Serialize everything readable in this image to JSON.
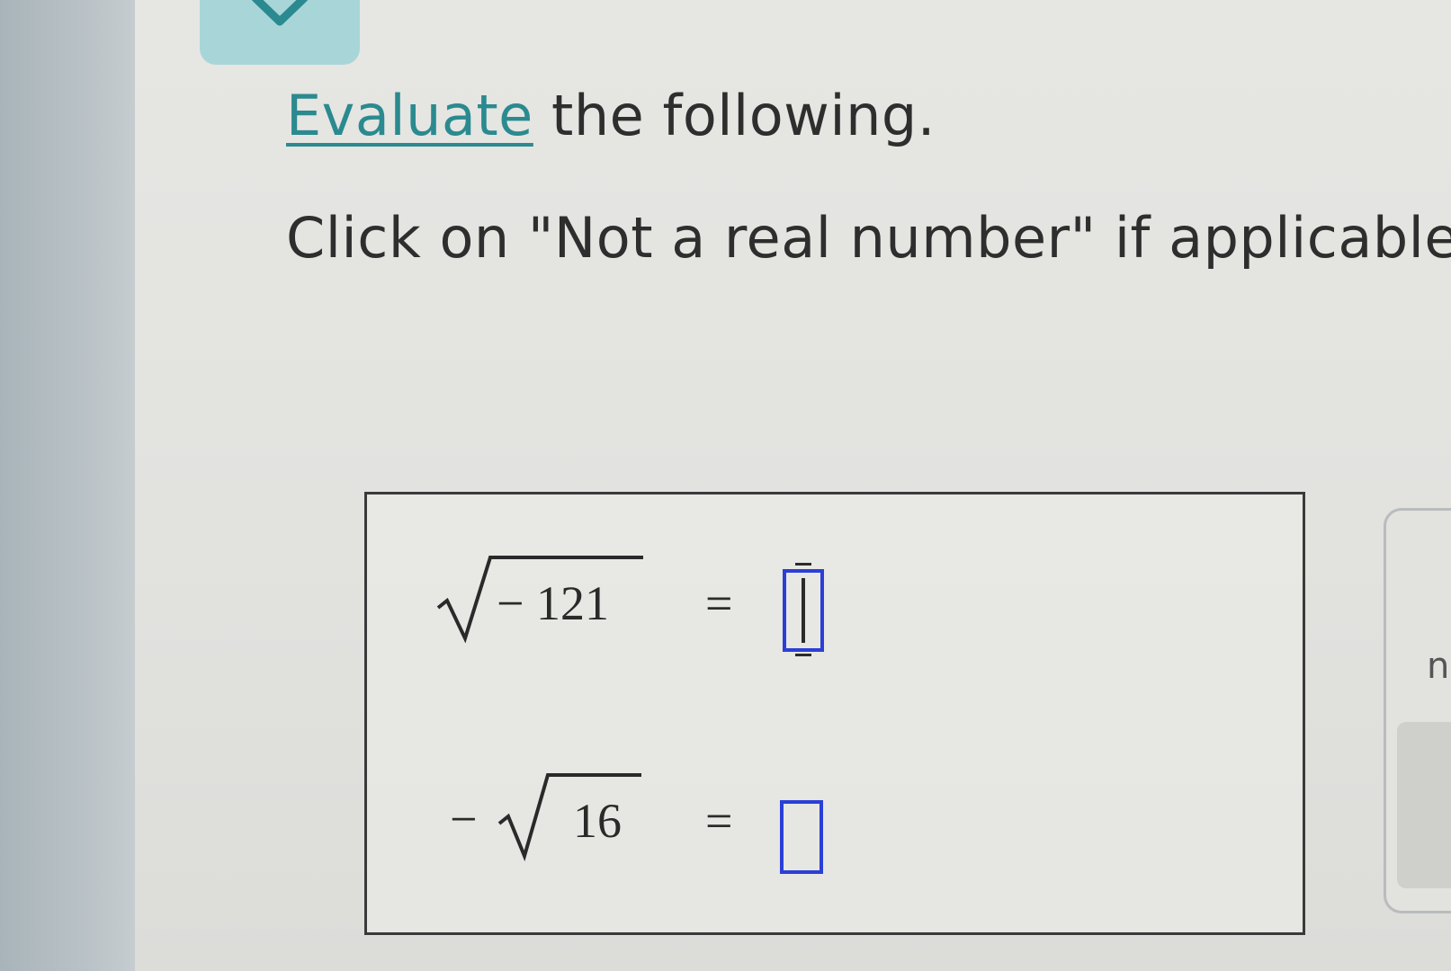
{
  "header": {
    "collapse_icon": "chevron-down-icon",
    "accent_color": "#a8d6d8"
  },
  "prompt": {
    "link_text": "Evaluate",
    "heading_rest": " the following.",
    "instruction": "Click on \"Not a real number\" if applicable."
  },
  "problems": [
    {
      "negative_prefix": "",
      "radicand": "− 121",
      "equals": "=",
      "answer_value": ""
    },
    {
      "negative_prefix": "−",
      "radicand": "16",
      "equals": "=",
      "answer_value": ""
    }
  ],
  "side_panel": {
    "label": "n"
  },
  "colors": {
    "link": "#2a8a8f",
    "input_border": "#2b3fd6"
  }
}
